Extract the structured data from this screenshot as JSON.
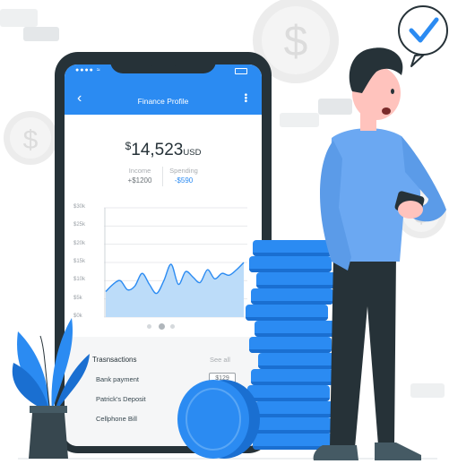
{
  "app": {
    "title": "Finance Profile"
  },
  "balance": {
    "currency_symbol": "$",
    "amount": "14,523",
    "currency_code": "USD"
  },
  "summary": {
    "income_label": "Income",
    "income_value": "+$1200",
    "spending_label": "Spending",
    "spending_value": "-$590"
  },
  "chart_data": {
    "type": "area",
    "y_ticks": [
      "$30k",
      "$25k",
      "$20k",
      "$15k",
      "$10k",
      "$5k",
      "$0k"
    ],
    "ylim": [
      0,
      30000
    ],
    "x": [
      0,
      1,
      2,
      3,
      4,
      5,
      6,
      7,
      8,
      9,
      10,
      11,
      12,
      13,
      14,
      15,
      16,
      17,
      18,
      19
    ],
    "series": [
      {
        "values": [
          7000,
          9000,
          10000,
          7500,
          8500,
          12000,
          9000,
          6500,
          10000,
          14500,
          9000,
          12500,
          11000,
          9500,
          13000,
          10500,
          12000,
          11500,
          13000,
          15000
        ]
      }
    ],
    "grid": true
  },
  "pagination": {
    "pages": 3,
    "active": 1
  },
  "transactions": {
    "title": "Trasnsactions",
    "see_all": "See all",
    "items": [
      {
        "label": "Bank payment",
        "amount": "$129"
      },
      {
        "label": "Patrick's Deposit",
        "amount": ""
      },
      {
        "label": "Cellphone Bill",
        "amount": ""
      }
    ]
  },
  "colors": {
    "accent": "#2b8bf2",
    "dark": "#263238",
    "chart_fill": "#bcdcf9",
    "coin": "#2b8bf2",
    "coin_edge": "#1a6fd1",
    "shirt": "#6ba8f2",
    "pants": "#263238"
  }
}
